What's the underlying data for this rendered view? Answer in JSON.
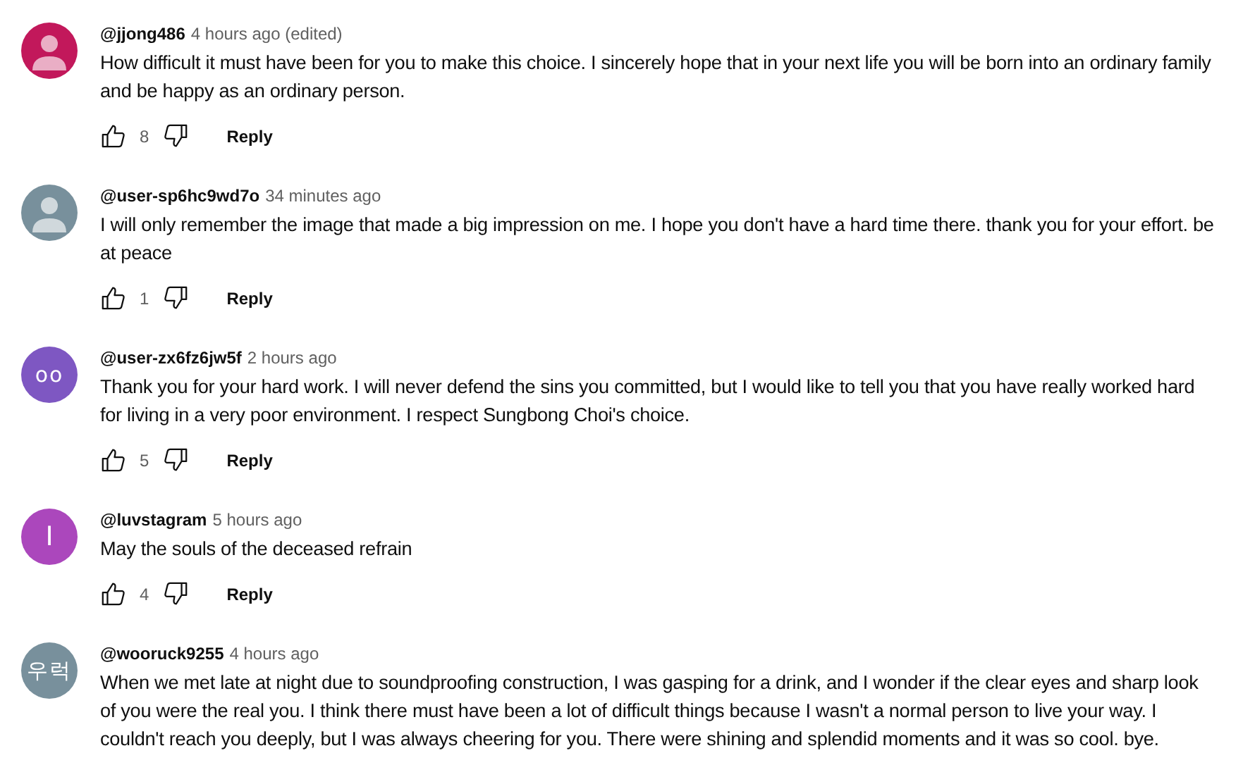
{
  "comments": [
    {
      "author": "@jjong486",
      "time": "4 hours ago (edited)",
      "avatar": {
        "kind": "silhouette",
        "color": "#c2185b"
      },
      "text": "How difficult it must have been for you to make this choice. I sincerely hope that in your next life you will be born into an ordinary family and be happy as an ordinary person.",
      "likes": "8",
      "reply": "Reply"
    },
    {
      "author": "@user-sp6hc9wd7o",
      "time": "34 minutes ago",
      "avatar": {
        "kind": "silhouette",
        "color": "#78909c"
      },
      "text": "I will only remember the image that made a big impression on me. I hope you don't have a hard time there. thank you for your effort. be at peace",
      "likes": "1",
      "reply": "Reply"
    },
    {
      "author": "@user-zx6fz6jw5f",
      "time": "2 hours ago",
      "avatar": {
        "kind": "initials",
        "color": "#7e57c2",
        "initials": "oo"
      },
      "text": "Thank you for your hard work. I will never defend the sins you committed, but I would like to tell you that you have really worked hard for living in a very poor environment. I respect Sungbong Choi's choice.",
      "likes": "5",
      "reply": "Reply"
    },
    {
      "author": "@luvstagram",
      "time": "5 hours ago",
      "avatar": {
        "kind": "initials",
        "color": "#ab47bc",
        "initials": "I"
      },
      "text": "May the souls of the deceased refrain",
      "likes": "4",
      "reply": "Reply"
    },
    {
      "author": "@wooruck9255",
      "time": "4 hours ago",
      "avatar": {
        "kind": "initials",
        "color": "#78909c",
        "initials": "우럭"
      },
      "text": "When we met late at night due to soundproofing construction, I was gasping for a drink, and I wonder if the clear eyes and sharp look of you were the real you. I think there must have been a lot of difficult things because I wasn't a normal person to live your way. I couldn't reach you deeply, but I was always cheering for you. There were shining and splendid moments and it was so cool. bye."
    }
  ]
}
